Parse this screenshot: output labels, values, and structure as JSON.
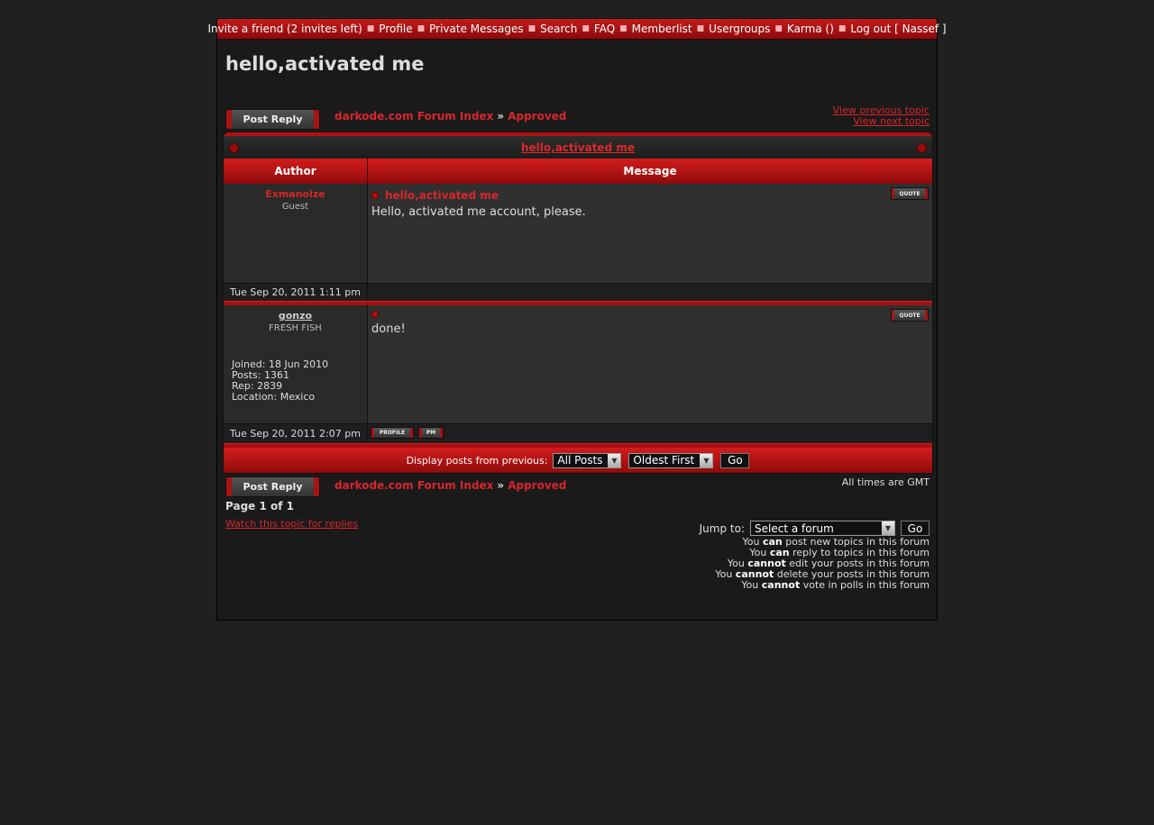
{
  "topnav": {
    "items": [
      "Invite a friend (2 invites left)",
      "Profile",
      "Private Messages",
      "Search",
      "FAQ",
      "Memberlist",
      "Usergroups",
      "Karma ()",
      "Log out [ Nassef ]"
    ]
  },
  "page": {
    "title": "hello,activated me"
  },
  "buttons": {
    "post_reply": "Post Reply",
    "quote": "QUOTE",
    "profile": "PROFILE",
    "pm": "PM",
    "go": "Go"
  },
  "breadcrumb": {
    "index": "darkode.com Forum Index",
    "separator": "»",
    "forum": "Approved"
  },
  "topicnav": {
    "prev": "View previous topic",
    "next": "View next topic"
  },
  "table": {
    "caption": "hello,activated me",
    "col_author": "Author",
    "col_message": "Message"
  },
  "posts": [
    {
      "author": "Exmanoize",
      "rank": "Guest",
      "subject": "hello,activated me",
      "body": "Hello, activated me account, please.",
      "date": "Tue Sep 20, 2011 1:11 pm"
    },
    {
      "author": "gonzo",
      "rank": "FRESH FISH",
      "joined": "Joined: 18 Jun 2010",
      "posts": "Posts: 1361",
      "rep": "Rep: 2839",
      "location": "Location: Mexico",
      "subject": "",
      "body": "done!",
      "date": "Tue Sep 20, 2011 2:07 pm"
    }
  ],
  "display": {
    "label": "Display posts from previous:",
    "range_value": "All Posts",
    "order_value": "Oldest First"
  },
  "footer": {
    "timezone": "All times are GMT",
    "page_info": "Page 1 of 1",
    "watch": "Watch this topic for replies",
    "jump_label": "Jump to:",
    "jump_value": "Select a forum",
    "perms": [
      {
        "pre": "You ",
        "b": "can",
        "post": " post new topics in this forum"
      },
      {
        "pre": "You ",
        "b": "can",
        "post": " reply to topics in this forum"
      },
      {
        "pre": "You ",
        "b": "cannot",
        "post": " edit your posts in this forum"
      },
      {
        "pre": "You ",
        "b": "cannot",
        "post": " delete your posts in this forum"
      },
      {
        "pre": "You ",
        "b": "cannot",
        "post": " vote in polls in this forum"
      }
    ]
  }
}
